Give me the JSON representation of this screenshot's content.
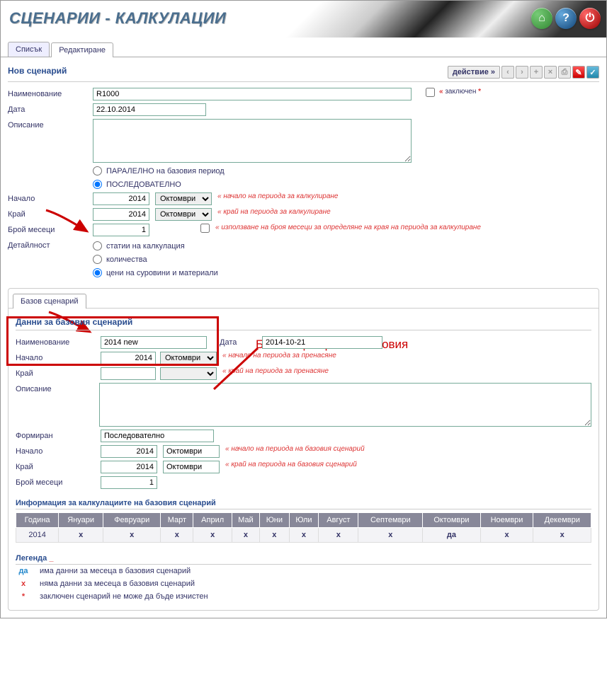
{
  "header": {
    "title": "СЦЕНАРИИ - КАЛКУЛАЦИИ"
  },
  "tabs": {
    "list": "Списък",
    "edit": "Редактиране"
  },
  "action": {
    "label": "действие »"
  },
  "section": {
    "new": "Нов сценарий"
  },
  "labels": {
    "name": "Наименование",
    "date": "Дата",
    "desc": "Описание",
    "start": "Начало",
    "end": "Край",
    "months": "Брой месеци",
    "detail": "Детайлност",
    "locked": "заключен",
    "formed": "Формиран",
    "date2": "Дата"
  },
  "values": {
    "name": "R1000",
    "date": "22.10.2014",
    "desc": "",
    "start_y": "2014",
    "start_m": "Октомври",
    "end_y": "2014",
    "end_m": "Октомври",
    "months": "1"
  },
  "radios": {
    "parallel": "ПАРАЛЕЛНО на базовия период",
    "sequential": "ПОСЛЕДОВАТЕЛНО",
    "detail1": "статии на калкулация",
    "detail2": "количества",
    "detail3": "цени на суровини и материали"
  },
  "hints": {
    "start": "« начало на периода за калкулиране",
    "end": "« край на периода за калкулиране",
    "months": "« използване на броя месеци за определяне на края на периода за калкулиране",
    "bstart": "« начало на периода за пренасяне",
    "bend": "« край на периода за пренасяне",
    "b_p_start": "« начало на периода на базовия сценарий",
    "b_p_end": "« край на периода на базовия сценарий"
  },
  "anno": "Базов сценарий е тестовия",
  "base_tab": "Базов сценарий",
  "base_section": "Данни за базовия сценарий",
  "base": {
    "name": "2014 new",
    "date": "2014-10-21",
    "start_y": "2014",
    "start_m": "Октомври",
    "end_y": "",
    "end_m": "",
    "desc": "",
    "formed": "Последователно",
    "p_start_y": "2014",
    "p_start_m": "Октомври",
    "p_end_y": "2014",
    "p_end_m": "Октомври",
    "months": "1"
  },
  "calc_head": "Информация за калкулациите на базовия сценарий",
  "calc_cols": {
    "year": "Година",
    "1": "Януари",
    "2": "Февруари",
    "3": "Март",
    "4": "Април",
    "5": "Май",
    "6": "Юни",
    "7": "Юли",
    "8": "Август",
    "9": "Септември",
    "10": "Октомври",
    "11": "Ноември",
    "12": "Декември"
  },
  "calc_row": {
    "year": "2014",
    "1": "x",
    "2": "x",
    "3": "x",
    "4": "x",
    "5": "x",
    "6": "x",
    "7": "x",
    "8": "x",
    "9": "x",
    "10": "да",
    "11": "x",
    "12": "x"
  },
  "legend_head": "Легенда",
  "legend": {
    "da_key": "да",
    "da_text": "има данни за месеца в базовия сценарий",
    "x_key": "x",
    "x_text": "няма данни за месеца в базовия сценарий",
    "ast_key": "*",
    "ast_text": "заключен сценарий не може да бъде изчистен"
  }
}
